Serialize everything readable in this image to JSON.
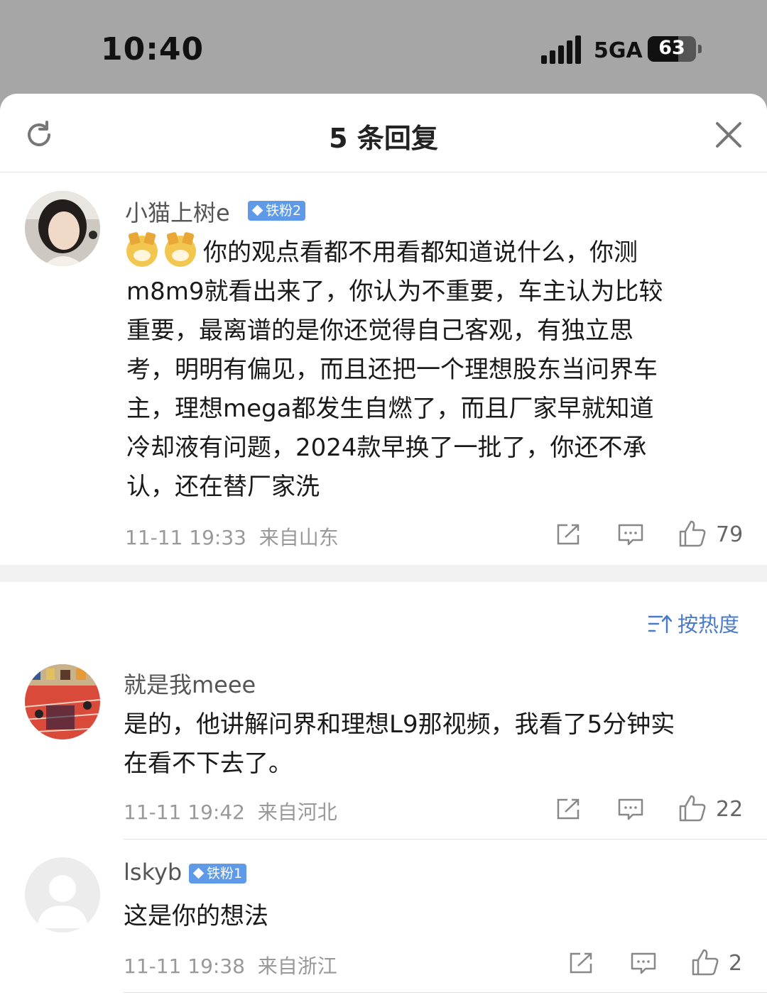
{
  "status_bar": {
    "time": "10:40",
    "network": "5GA",
    "battery_level": 63,
    "battery_label": "63"
  },
  "sheet": {
    "title": "5 条回复",
    "refresh_icon": "refresh-icon",
    "close_icon": "close-icon"
  },
  "main_comment": {
    "username": "小猫上树e",
    "badge": "铁粉2",
    "emoji": [
      "doge-emoji",
      "doge-emoji"
    ],
    "lines": [
      "你的观点看都不用看都知道说什么，你测",
      "m8m9就看出来了，你认为不重要，车主认为比较",
      "重要，最离谱的是你还觉得自己客观，有独立思",
      "考，明明有偏见，而且还把一个理想股东当问界车",
      "主，理想mega都发生自燃了，而且厂家早就知道",
      "冷却液有问题，2024款早换了一批了，你还不承",
      "认，还在替厂家洗"
    ],
    "timestamp": "11-11 19:33",
    "location": "来自山东",
    "likes": "79"
  },
  "sort": {
    "label": "按热度"
  },
  "replies": [
    {
      "username": "就是我meee",
      "badge": "",
      "lines": [
        "是的，他讲解问界和理想L9那视频，我看了5分钟实",
        "在看不下去了。"
      ],
      "timestamp": "11-11 19:42",
      "location": "来自河北",
      "likes": "22"
    },
    {
      "username": "lskyb",
      "badge": "铁粉1",
      "lines": [
        "这是你的想法"
      ],
      "timestamp": "11-11 19:38",
      "location": "来自浙江",
      "likes": "2"
    }
  ],
  "colors": {
    "accent": "#4a7bc9",
    "badge": "#5f9ae8",
    "status_bg": "#a6a6a6"
  }
}
